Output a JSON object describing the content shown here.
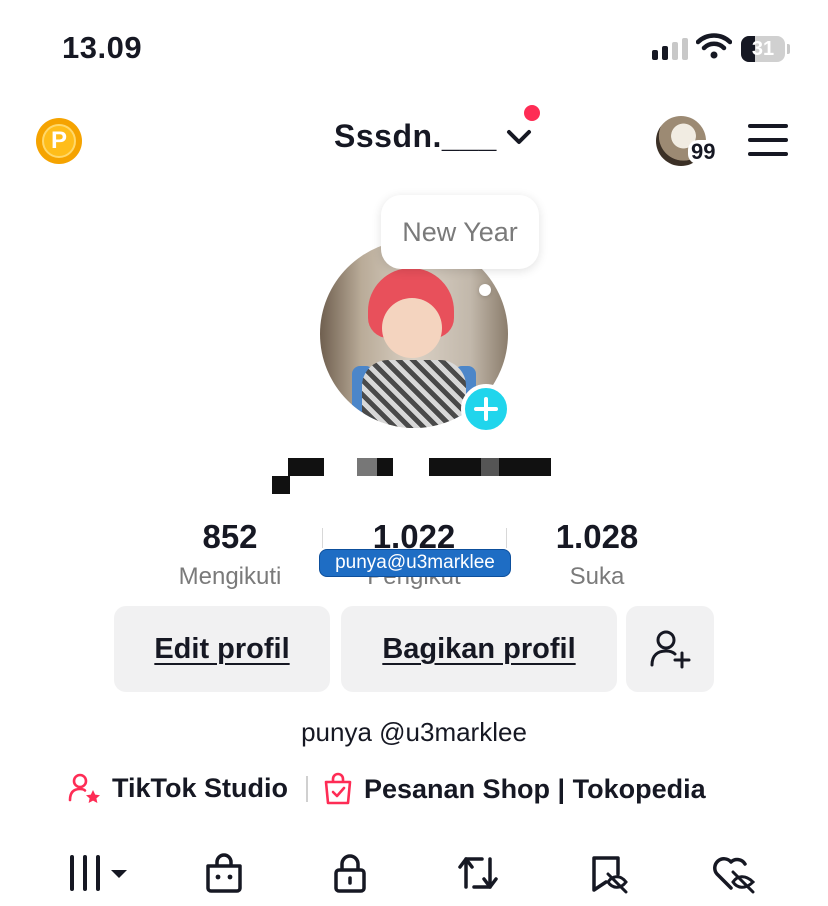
{
  "status_bar": {
    "time": "13.09",
    "battery": "31"
  },
  "header": {
    "coin_label": "P",
    "username": "Sssdn.___",
    "friends_count": "99"
  },
  "note": {
    "text": "New Year"
  },
  "stats": {
    "following": {
      "value": "852",
      "label": "Mengikuti"
    },
    "followers": {
      "value": "1.022",
      "label": "Pengikut"
    },
    "likes": {
      "value": "1.028",
      "label": "Suka"
    }
  },
  "overlay_tag": "punya@u3marklee",
  "buttons": {
    "edit_profile": "Edit profil",
    "share_profile": "Bagikan profil"
  },
  "bio": "punya @u3marklee",
  "links": {
    "studio": "TikTok Studio",
    "shop": "Pesanan Shop | Tokopedia"
  },
  "icons": {
    "coin": "coin-icon",
    "chevron": "chevron-down-icon",
    "menu": "hamburger-menu-icon",
    "add": "plus-icon",
    "add_friend": "add-person-icon",
    "studio": "person-star-icon",
    "shop": "shopping-bag-icon",
    "tabs": [
      "videos-grid-icon",
      "shop-icon",
      "lock-icon",
      "repost-icon",
      "favorites-icon",
      "liked-icon"
    ]
  },
  "colors": {
    "accent": "#fe2c55",
    "avatar_add": "#20d5ec",
    "coin": "#f5a300"
  }
}
